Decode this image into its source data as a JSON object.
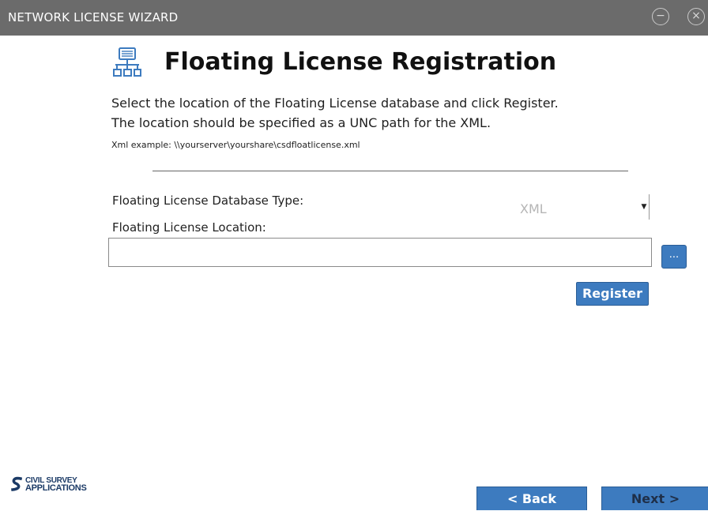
{
  "window": {
    "title": "NETWORK LICENSE WIZARD",
    "minimize_glyph": "−",
    "close_glyph": "×"
  },
  "header": {
    "icon": "network-icon",
    "title": "Floating License Registration"
  },
  "description": {
    "line1": "Select the location of the Floating License database and click Register.",
    "line2": "The location should be specified as a UNC path for the XML.",
    "example": "Xml example: \\\\yourserver\\yourshare\\csdfloatlicense.xml"
  },
  "form": {
    "db_type_label": "Floating License Database Type:",
    "db_type_value": "XML",
    "location_label": "Floating License Location:",
    "location_value": "",
    "browse_label": "...",
    "register_label": "Register"
  },
  "footer": {
    "logo_line1": "CIVIL SURVEY",
    "logo_line2": "APPLICATIONS",
    "back_label": "< Back",
    "next_label": "Next >"
  },
  "colors": {
    "titlebar": "#6b6b6b",
    "button": "#3d7bbf",
    "logo": "#1b3a66"
  }
}
